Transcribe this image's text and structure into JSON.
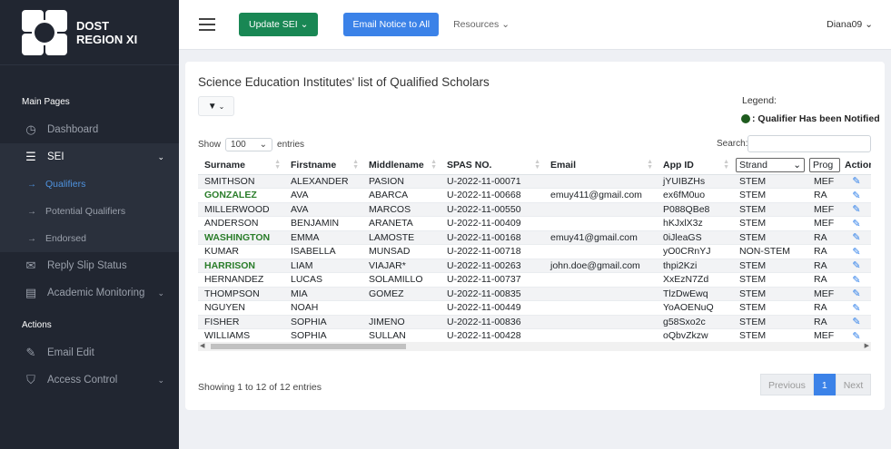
{
  "brand": {
    "line1": "DOST",
    "line2": "REGION XI"
  },
  "sidebar": {
    "heading_main": "Main Pages",
    "dashboard": "Dashboard",
    "sei": "SEI",
    "sub": [
      "Qualifiers",
      "Potential Qualifiers",
      "Endorsed"
    ],
    "reply": "Reply Slip Status",
    "academic": "Academic Monitoring",
    "heading_actions": "Actions",
    "email_edit": "Email Edit",
    "access": "Access Control"
  },
  "topbar": {
    "update_label": "Update SEI",
    "email_label": "Email Notice to All",
    "resources_label": "Resources",
    "user": "Diana09"
  },
  "card": {
    "title": "Science Education Institutes' list of Qualified Scholars",
    "legend_title": "Legend:",
    "legend_item": ": Qualifier Has been Notified",
    "show_label": "Show",
    "show_value": "100",
    "entries_label": "entries",
    "search_label": "Search:",
    "showing": "Showing 1 to 12 of 12 entries",
    "prev": "Previous",
    "page": "1",
    "next": "Next"
  },
  "table": {
    "headers": [
      "Surname",
      "Firstname",
      "Middlename",
      "SPAS NO.",
      "Email",
      "App ID",
      "Strand",
      "Prog",
      "Action"
    ],
    "rows": [
      [
        "SMITHSON",
        "ALEXANDER",
        "PASION",
        "U-2022-11-00071",
        "",
        "jYUIBZHs",
        "STEM",
        "MEF"
      ],
      [
        "GONZALEZ",
        "AVA",
        "ABARCA",
        "U-2022-11-00668",
        "emuy411@gmail.com",
        "ex6fM0uo",
        "STEM",
        "RA"
      ],
      [
        "MILLERWOOD",
        "AVA",
        "MARCOS",
        "U-2022-11-00550",
        "",
        "P088QBe8",
        "STEM",
        "MEF"
      ],
      [
        "ANDERSON",
        "BENJAMIN",
        "ARANETA",
        "U-2022-11-00409",
        "",
        "hKJxlX3z",
        "STEM",
        "MEF"
      ],
      [
        "WASHINGTON",
        "EMMA",
        "LAMOSTE",
        "U-2022-11-00168",
        "emuy41@gmail.com",
        "0iJleaGS",
        "STEM",
        "RA"
      ],
      [
        "KUMAR",
        "ISABELLA",
        "MUNSAD",
        "U-2022-11-00718",
        "",
        "yO0CRnYJ",
        "NON-STEM",
        "RA"
      ],
      [
        "HARRISON",
        "LIAM",
        "VIAJAR*",
        "U-2022-11-00263",
        "john.doe@gmail.com",
        "thpi2Kzi",
        "STEM",
        "RA"
      ],
      [
        "HERNANDEZ",
        "LUCAS",
        "SOLAMILLO",
        "U-2022-11-00737",
        "",
        "XxEzN7Zd",
        "STEM",
        "RA"
      ],
      [
        "THOMPSON",
        "MIA",
        "GOMEZ",
        "U-2022-11-00835",
        "",
        "TlzDwEwq",
        "STEM",
        "MEF"
      ],
      [
        "NGUYEN",
        "NOAH",
        "",
        "U-2022-11-00449",
        "",
        "YoAOENuQ",
        "STEM",
        "RA"
      ],
      [
        "FISHER",
        "SOPHIA",
        "JIMENO",
        "U-2022-11-00836",
        "",
        "g58Sxo2c",
        "STEM",
        "RA"
      ],
      [
        "WILLIAMS",
        "SOPHIA",
        "SULLAN",
        "U-2022-11-00428",
        "",
        "oQbvZkzw",
        "STEM",
        "MEF"
      ]
    ],
    "notified_rows": [
      1,
      4,
      6
    ]
  },
  "colors": {
    "notified": "#2a7d2a",
    "primary": "#3b82e8",
    "success": "#198754"
  }
}
